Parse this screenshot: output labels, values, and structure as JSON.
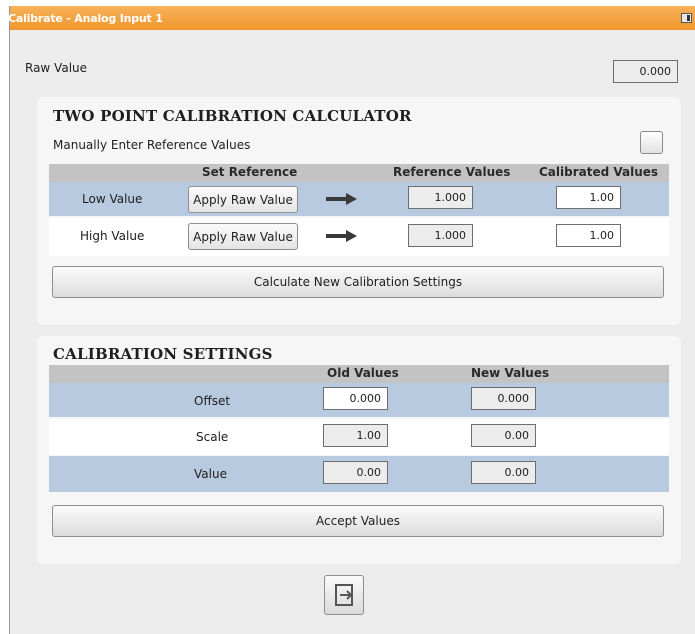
{
  "window": {
    "title": "Calibrate - Analog Input 1",
    "title_icon": "restore-window-icon"
  },
  "raw": {
    "label": "Raw Value",
    "value": "0.000"
  },
  "calculator": {
    "title": "TWO POINT CALIBRATION CALCULATOR",
    "manual_label": "Manually Enter Reference Values",
    "headers": {
      "set_reference": "Set Reference",
      "reference_values": "Reference Values",
      "calibrated_values": "Calibrated Values"
    },
    "rows": [
      {
        "label": "Low Value",
        "button": "Apply Raw Value",
        "reference": "1.000",
        "calibrated": "1.00"
      },
      {
        "label": "High Value",
        "button": "Apply Raw Value",
        "reference": "1.000",
        "calibrated": "1.00"
      }
    ],
    "calculate_button": "Calculate New Calibration Settings"
  },
  "settings": {
    "title": "CALIBRATION SETTINGS",
    "headers": {
      "old": "Old Values",
      "new": "New Values"
    },
    "rows": [
      {
        "label": "Offset",
        "old": "0.000",
        "new": "0.000"
      },
      {
        "label": "Scale",
        "old": "1.00",
        "new": "0.00"
      },
      {
        "label": "Value",
        "old": "0.00",
        "new": "0.00"
      }
    ],
    "accept_button": "Accept Values"
  },
  "colors": {
    "title_orange": "#ef962d",
    "row_blue": "#b8cadf",
    "header_gray": "#c3c3c3"
  },
  "footer": {
    "exit_icon": "exit-door-icon"
  }
}
